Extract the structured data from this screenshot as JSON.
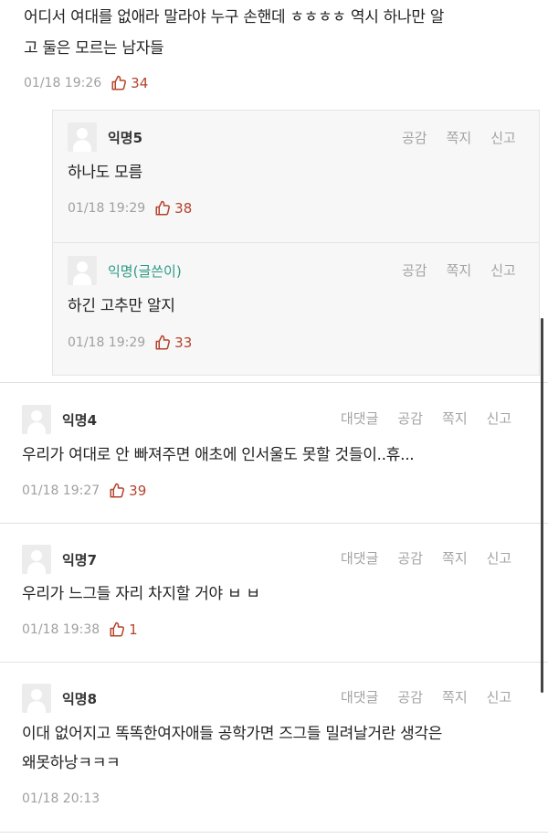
{
  "top_comment": {
    "text_line1": "어디서 여대를 없애라 말라야 누구 손핸데 ㅎㅎㅎㅎ 역시 하나만 알",
    "text_line2": "고 둘은 모르는 남자들",
    "timestamp": "01/18 19:26",
    "likes": "34"
  },
  "replies": [
    {
      "author": "익명5",
      "actions": [
        "공감",
        "쪽지",
        "신고"
      ],
      "text": "하나도 모름",
      "timestamp": "01/18 19:29",
      "likes": "38"
    },
    {
      "author": "익명(글쓴이)",
      "actions": [
        "공감",
        "쪽지",
        "신고"
      ],
      "text": "하긴 고추만 알지",
      "timestamp": "01/18 19:29",
      "likes": "33"
    }
  ],
  "comments": [
    {
      "author": "익명4",
      "actions": [
        "대댓글",
        "공감",
        "쪽지",
        "신고"
      ],
      "text": "우리가 여대로 안 빠져주면 애초에 인서울도 못할 것들이..휴...",
      "timestamp": "01/18 19:27",
      "likes": "39"
    },
    {
      "author": "익명7",
      "actions": [
        "대댓글",
        "공감",
        "쪽지",
        "신고"
      ],
      "text": "우리가 느그들 자리 차지할 거야 ㅂ ㅂ",
      "timestamp": "01/18 19:38",
      "likes": "1"
    },
    {
      "author": "익명8",
      "actions": [
        "대댓글",
        "공감",
        "쪽지",
        "신고"
      ],
      "text_line1": "이대 없어지고 똑똑한여자애들 공학가면 즈그들 밀려날거란 생각은",
      "text_line2": "왜못하낭ㅋㅋㅋ",
      "timestamp": "01/18 20:13"
    }
  ],
  "icons": {
    "like": "thumbs-up-icon",
    "avatar": "default-avatar-icon"
  },
  "colors": {
    "like": "#b5432c",
    "op_author": "#2b9a86",
    "meta": "#a0a0a0"
  }
}
